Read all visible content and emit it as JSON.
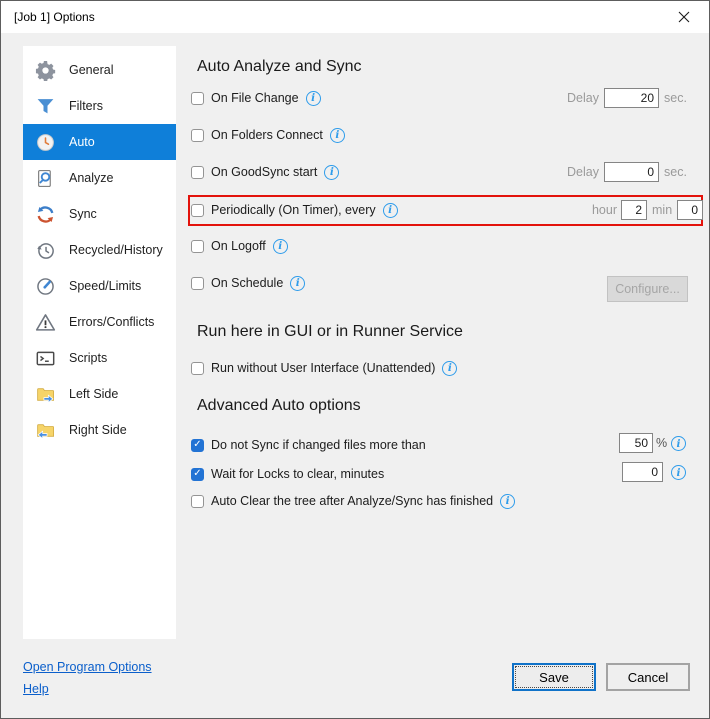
{
  "window": {
    "title": "[Job 1] Options"
  },
  "colors": {
    "accent_blue": "#0f7fd9",
    "checkbox_checked": "#2273d4",
    "highlight_red": "#e3120b",
    "link_blue": "#0b5fcb",
    "info_blue": "#2e9ceb"
  },
  "sidebar": {
    "items": [
      {
        "label": "General",
        "icon": "gear-icon",
        "selected": false
      },
      {
        "label": "Filters",
        "icon": "filter-icon",
        "selected": false
      },
      {
        "label": "Auto",
        "icon": "clock-icon",
        "selected": true
      },
      {
        "label": "Analyze",
        "icon": "analyze-icon",
        "selected": false
      },
      {
        "label": "Sync",
        "icon": "sync-icon",
        "selected": false
      },
      {
        "label": "Recycled/History",
        "icon": "history-icon",
        "selected": false
      },
      {
        "label": "Speed/Limits",
        "icon": "gauge-icon",
        "selected": false
      },
      {
        "label": "Errors/Conflicts",
        "icon": "warning-icon",
        "selected": false
      },
      {
        "label": "Scripts",
        "icon": "terminal-icon",
        "selected": false
      },
      {
        "label": "Left Side",
        "icon": "folder-arrow-right-icon",
        "selected": false
      },
      {
        "label": "Right Side",
        "icon": "folder-arrow-left-icon",
        "selected": false
      }
    ]
  },
  "auto_section": {
    "title": "Auto Analyze and Sync",
    "on_file_change": {
      "label": "On File Change",
      "checked": false,
      "delay_label": "Delay",
      "delay_value": "20",
      "unit": "sec."
    },
    "on_folders_connect": {
      "label": "On Folders Connect",
      "checked": false
    },
    "on_goodsync_start": {
      "label": "On GoodSync start",
      "checked": false,
      "delay_label": "Delay",
      "delay_value": "0",
      "unit": "sec."
    },
    "periodically": {
      "label": "Periodically (On Timer), every",
      "checked": false,
      "highlighted": true,
      "hour_label": "hour",
      "hour_value": "2",
      "min_label": "min",
      "min_value": "0"
    },
    "on_logoff": {
      "label": "On Logoff",
      "checked": false
    },
    "on_schedule": {
      "label": "On Schedule",
      "checked": false,
      "configure_button": "Configure...",
      "configure_enabled": false
    }
  },
  "runner_section": {
    "title": "Run here in GUI or in Runner Service",
    "run_without_ui": {
      "label": "Run without User Interface (Unattended)",
      "checked": false
    }
  },
  "advanced_section": {
    "title": "Advanced Auto options",
    "do_not_sync": {
      "label": "Do not Sync if changed files more than",
      "checked": true,
      "value": "50",
      "suffix": "%"
    },
    "wait_for_locks": {
      "label": "Wait for Locks to clear, minutes",
      "checked": true,
      "value": "0"
    },
    "auto_clear": {
      "label": "Auto Clear the tree after Analyze/Sync has finished",
      "checked": false
    }
  },
  "footer": {
    "link_program_options": "Open Program Options",
    "link_help": "Help",
    "save_button": "Save",
    "cancel_button": "Cancel"
  }
}
